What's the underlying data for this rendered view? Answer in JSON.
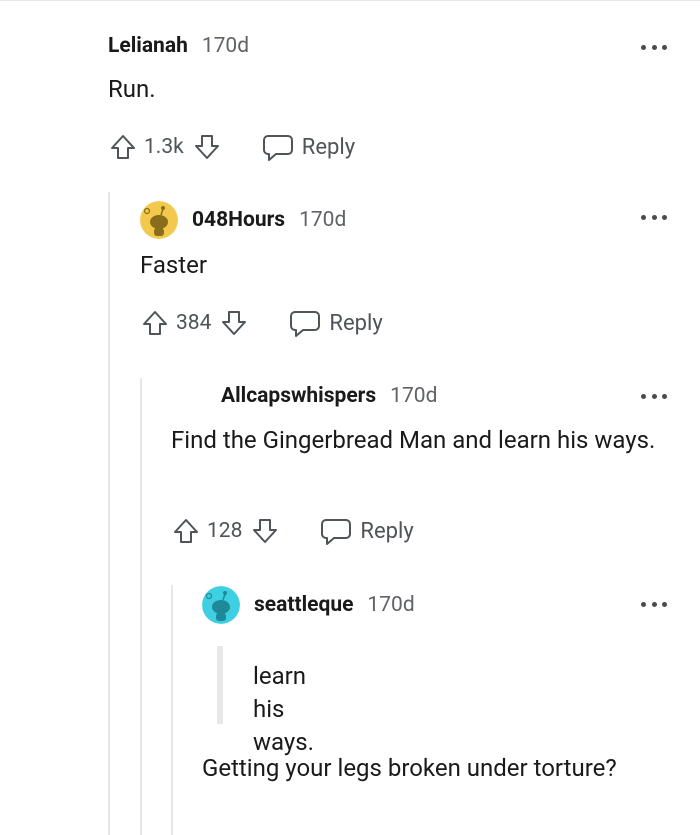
{
  "comments": [
    {
      "username": "Lelianah",
      "age": "170d",
      "text": "Run.",
      "score": "1.3k",
      "reply_label": "Reply"
    },
    {
      "username": "048Hours",
      "age": "170d",
      "text": "Faster",
      "score": "384",
      "reply_label": "Reply",
      "avatar_color": "#f2c94c"
    },
    {
      "username": "Allcapswhispers",
      "age": "170d",
      "text": "Find the Gingerbread Man and learn his ways.",
      "score": "128",
      "reply_label": "Reply"
    },
    {
      "username": "seattleque",
      "age": "170d",
      "quote": "learn his ways.",
      "text": "Getting your legs broken under torture?",
      "avatar_color": "#3fcfe2"
    }
  ],
  "colors": {
    "text": "#1a1a1b",
    "meta": "#5f6368",
    "thread_line": "#e6e6e6"
  }
}
